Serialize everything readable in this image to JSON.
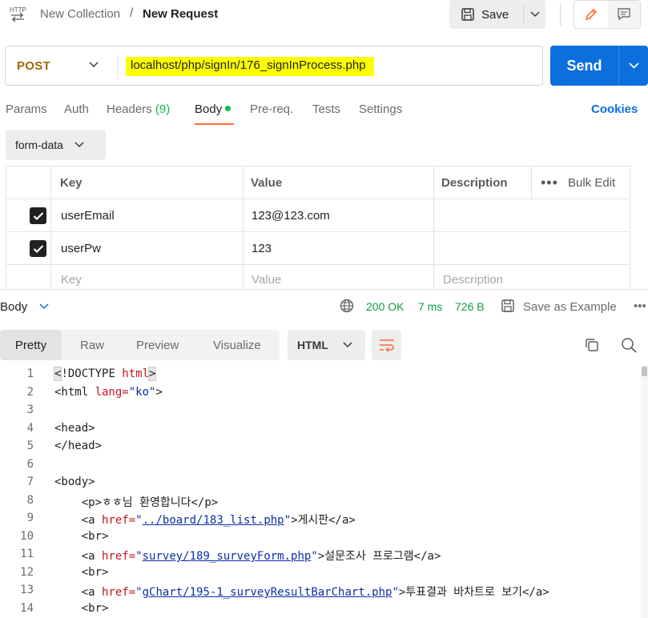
{
  "header": {
    "protocol_icon": "http-icon",
    "breadcrumb_parent": "New Collection",
    "breadcrumb_sep": "/",
    "breadcrumb_current": "New Request",
    "save_label": "Save"
  },
  "request": {
    "method": "POST",
    "url": "localhost/php/signIn/176_signInProcess.php",
    "send_label": "Send",
    "url_highlight_color": "#fffe00",
    "send_color": "#0c6fde"
  },
  "tabs": {
    "params": "Params",
    "auth": "Auth",
    "headers": "Headers",
    "headers_count": "(9)",
    "body": "Body",
    "prereq": "Pre-req.",
    "tests": "Tests",
    "settings": "Settings",
    "cookies": "Cookies"
  },
  "body": {
    "type": "form-data",
    "columns": {
      "key": "Key",
      "value": "Value",
      "description": "Description",
      "bulk_edit": "Bulk Edit"
    },
    "rows": [
      {
        "checked": true,
        "key": "userEmail",
        "value": "123@123.com",
        "description": ""
      },
      {
        "checked": true,
        "key": "userPw",
        "value": "123",
        "description": ""
      }
    ],
    "placeholder": {
      "key": "Key",
      "value": "Value",
      "description": "Description"
    }
  },
  "response": {
    "label": "Body",
    "status": "200 OK",
    "time": "7 ms",
    "size": "726 B",
    "save_example": "Save as Example",
    "more": "•••",
    "views": [
      "Pretty",
      "Raw",
      "Preview",
      "Visualize"
    ],
    "active_view": "Pretty",
    "language": "HTML",
    "status_color": "#0c9c46"
  },
  "code": {
    "l1a": "<!DOCTYPE ",
    "l1b": "html",
    "l1c": ">",
    "l2a": "<html ",
    "l2b": "lang=",
    "l2c": "\"ko\"",
    "l2d": ">",
    "l4": "<head>",
    "l5": "</head>",
    "l7": "<body>",
    "l8": "    <p>ㅎㅎ님 환영합니다</p>",
    "l9a": "    <a ",
    "l9b": "href=",
    "l9c": "\"",
    "l9d": "../board/183_list.php",
    "l9e": "\"",
    "l9f": ">게시판</a>",
    "l10": "    <br>",
    "l11a": "    <a ",
    "l11b": "href=",
    "l11c": "\"",
    "l11d": "survey/189_surveyForm.php",
    "l11e": "\"",
    "l11f": ">설문조사 프로그램</a>",
    "l12": "    <br>",
    "l13a": "    <a ",
    "l13b": "href=",
    "l13c": "\"",
    "l13d": "gChart/195-1_surveyResultBarChart.php",
    "l13e": "\"",
    "l13f": ">투표결과 바차트로 보기</a>",
    "l14": "    <br>",
    "numbers": [
      "1",
      "2",
      "3",
      "4",
      "5",
      "6",
      "7",
      "8",
      "9",
      "10",
      "11",
      "12",
      "13",
      "14"
    ]
  }
}
